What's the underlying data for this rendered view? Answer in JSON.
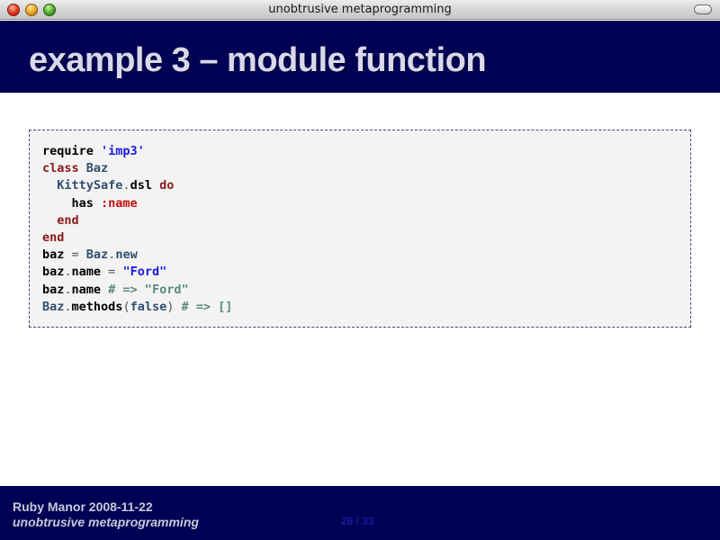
{
  "window": {
    "title": "unobtrusive metaprogramming"
  },
  "slide": {
    "title": "example 3 – module function"
  },
  "code": {
    "lines": [
      [
        {
          "t": "require ",
          "c": "plain"
        },
        {
          "t": "'imp3'",
          "c": "str"
        }
      ],
      [
        {
          "t": "class ",
          "c": "kw"
        },
        {
          "t": "Baz",
          "c": "cls"
        }
      ],
      [
        {
          "t": "  ",
          "c": "plain"
        },
        {
          "t": "KittySafe",
          "c": "cls"
        },
        {
          "t": ".",
          "c": "op"
        },
        {
          "t": "dsl ",
          "c": "plain"
        },
        {
          "t": "do",
          "c": "kw"
        }
      ],
      [
        {
          "t": "    has ",
          "c": "plain"
        },
        {
          "t": ":name",
          "c": "sym"
        }
      ],
      [
        {
          "t": "  ",
          "c": "plain"
        },
        {
          "t": "end",
          "c": "kw"
        }
      ],
      [
        {
          "t": "end",
          "c": "kw"
        }
      ],
      [
        {
          "t": "baz ",
          "c": "plain"
        },
        {
          "t": "=",
          "c": "op"
        },
        {
          "t": " ",
          "c": "plain"
        },
        {
          "t": "Baz",
          "c": "cls"
        },
        {
          "t": ".",
          "c": "op"
        },
        {
          "t": "new",
          "c": "cls"
        }
      ],
      [
        {
          "t": "baz",
          "c": "plain"
        },
        {
          "t": ".",
          "c": "op"
        },
        {
          "t": "name ",
          "c": "plain"
        },
        {
          "t": "=",
          "c": "op"
        },
        {
          "t": " ",
          "c": "plain"
        },
        {
          "t": "\"Ford\"",
          "c": "str"
        }
      ],
      [
        {
          "t": "baz",
          "c": "plain"
        },
        {
          "t": ".",
          "c": "op"
        },
        {
          "t": "name ",
          "c": "plain"
        },
        {
          "t": "# => \"Ford\"",
          "c": "cmt"
        }
      ],
      [
        {
          "t": "Baz",
          "c": "cls"
        },
        {
          "t": ".",
          "c": "op"
        },
        {
          "t": "methods",
          "c": "plain"
        },
        {
          "t": "(",
          "c": "op"
        },
        {
          "t": "false",
          "c": "cls"
        },
        {
          "t": ")",
          "c": "op"
        },
        {
          "t": " ",
          "c": "plain"
        },
        {
          "t": "# => []",
          "c": "cmt"
        }
      ]
    ]
  },
  "footer": {
    "event": "Ruby Manor 2008-11-22",
    "talk": "unobtrusive metaprogramming",
    "page": "26 / 33"
  },
  "colors": {
    "header_bg": "#000055",
    "footer_bg": "#000055",
    "code_bg": "#f3f3f3",
    "keyword": "#8b1a1a",
    "constant": "#2f4f6f",
    "string": "#1a1add",
    "symbol": "#c41010",
    "comment": "#5a8a7a"
  }
}
